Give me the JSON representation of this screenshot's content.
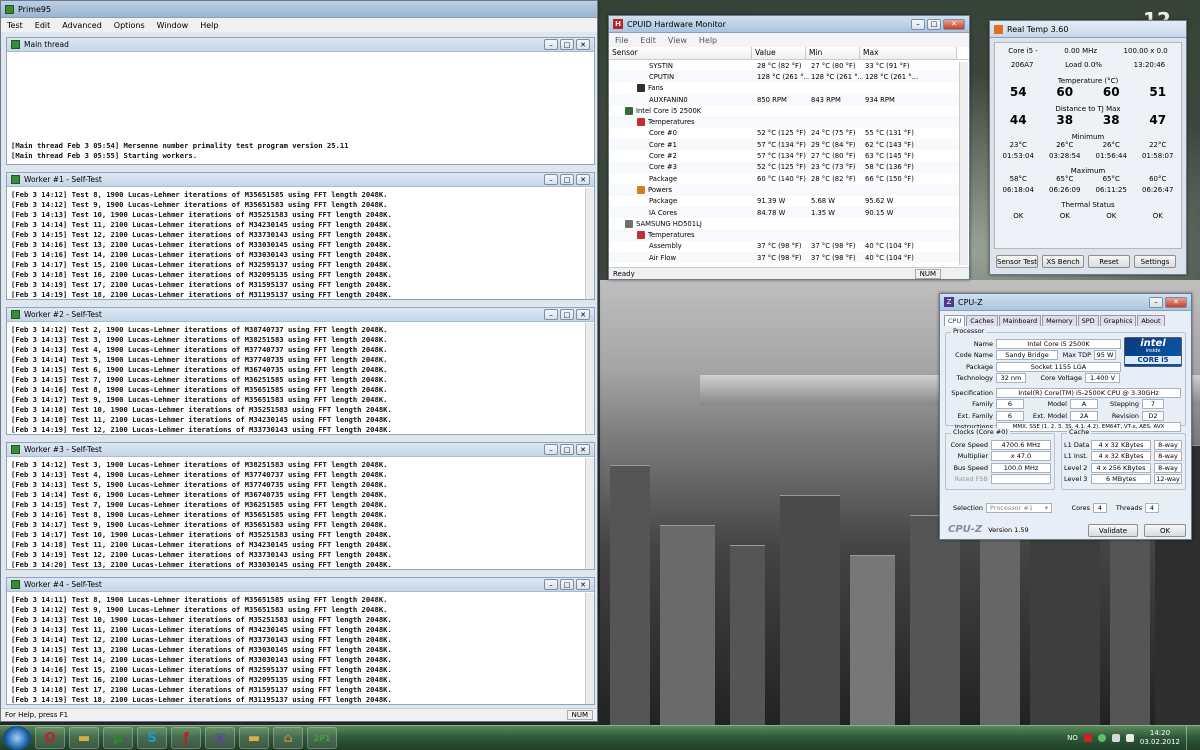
{
  "desktop": {
    "clock_big": "12"
  },
  "prime95": {
    "title": "Prime95",
    "menu": [
      "Test",
      "Edit",
      "Advanced",
      "Options",
      "Window",
      "Help"
    ],
    "main_thread": {
      "title": "Main thread",
      "lines": [
        "[Main thread Feb 3 05:54] Mersenne number primality test program version 25.11",
        "[Main thread Feb 3 05:55] Starting workers."
      ]
    },
    "workers": [
      {
        "title": "Worker #1 - Self-Test",
        "lines": [
          "[Feb 3 14:12] Test 8, 1900 Lucas-Lehmer iterations of M35651585 using FFT length 2048K.",
          "[Feb 3 14:12] Test 9, 1900 Lucas-Lehmer iterations of M35651583 using FFT length 2048K.",
          "[Feb 3 14:13] Test 10, 1900 Lucas-Lehmer iterations of M35251583 using FFT length 2048K.",
          "[Feb 3 14:14] Test 11, 2100 Lucas-Lehmer iterations of M34230145 using FFT length 2048K.",
          "[Feb 3 14:15] Test 12, 2100 Lucas-Lehmer iterations of M33730143 using FFT length 2048K.",
          "[Feb 3 14:16] Test 13, 2100 Lucas-Lehmer iterations of M33030145 using FFT length 2048K.",
          "[Feb 3 14:16] Test 14, 2100 Lucas-Lehmer iterations of M33030143 using FFT length 2048K.",
          "[Feb 3 14:17] Test 15, 2100 Lucas-Lehmer iterations of M32595137 using FFT length 2048K.",
          "[Feb 3 14:18] Test 16, 2100 Lucas-Lehmer iterations of M32095135 using FFT length 2048K.",
          "[Feb 3 14:19] Test 17, 2100 Lucas-Lehmer iterations of M31595137 using FFT length 2048K.",
          "[Feb 3 14:19] Test 18, 2100 Lucas-Lehmer iterations of M31195137 using FFT length 2048K."
        ]
      },
      {
        "title": "Worker #2 - Self-Test",
        "lines": [
          "[Feb 3 14:12] Test 2, 1900 Lucas-Lehmer iterations of M38740737 using FFT length 2048K.",
          "[Feb 3 14:13] Test 3, 1900 Lucas-Lehmer iterations of M38251583 using FFT length 2048K.",
          "[Feb 3 14:13] Test 4, 1900 Lucas-Lehmer iterations of M37740737 using FFT length 2048K.",
          "[Feb 3 14:14] Test 5, 1900 Lucas-Lehmer iterations of M37740735 using FFT length 2048K.",
          "[Feb 3 14:15] Test 6, 1900 Lucas-Lehmer iterations of M36740735 using FFT length 2048K.",
          "[Feb 3 14:15] Test 7, 1900 Lucas-Lehmer iterations of M36251585 using FFT length 2048K.",
          "[Feb 3 14:16] Test 8, 1900 Lucas-Lehmer iterations of M35651585 using FFT length 2048K.",
          "[Feb 3 14:17] Test 9, 1900 Lucas-Lehmer iterations of M35651583 using FFT length 2048K.",
          "[Feb 3 14:18] Test 10, 1900 Lucas-Lehmer iterations of M35251583 using FFT length 2048K.",
          "[Feb 3 14:18] Test 11, 2100 Lucas-Lehmer iterations of M34230145 using FFT length 2048K.",
          "[Feb 3 14:19] Test 12, 2100 Lucas-Lehmer iterations of M33730143 using FFT length 2048K."
        ]
      },
      {
        "title": "Worker #3 - Self-Test",
        "lines": [
          "[Feb 3 14:12] Test 3, 1900 Lucas-Lehmer iterations of M38251583 using FFT length 2048K.",
          "[Feb 3 14:13] Test 4, 1900 Lucas-Lehmer iterations of M37740737 using FFT length 2048K.",
          "[Feb 3 14:13] Test 5, 1900 Lucas-Lehmer iterations of M37740735 using FFT length 2048K.",
          "[Feb 3 14:14] Test 6, 1900 Lucas-Lehmer iterations of M36740735 using FFT length 2048K.",
          "[Feb 3 14:15] Test 7, 1900 Lucas-Lehmer iterations of M36251585 using FFT length 2048K.",
          "[Feb 3 14:16] Test 8, 1900 Lucas-Lehmer iterations of M35651585 using FFT length 2048K.",
          "[Feb 3 14:17] Test 9, 1900 Lucas-Lehmer iterations of M35651583 using FFT length 2048K.",
          "[Feb 3 14:17] Test 10, 1900 Lucas-Lehmer iterations of M35251583 using FFT length 2048K.",
          "[Feb 3 14:18] Test 11, 2100 Lucas-Lehmer iterations of M34230145 using FFT length 2048K.",
          "[Feb 3 14:19] Test 12, 2100 Lucas-Lehmer iterations of M33730143 using FFT length 2048K.",
          "[Feb 3 14:20] Test 13, 2100 Lucas-Lehmer iterations of M33030145 using FFT length 2048K."
        ]
      },
      {
        "title": "Worker #4 - Self-Test",
        "lines": [
          "[Feb 3 14:11] Test 8, 1900 Lucas-Lehmer iterations of M35651585 using FFT length 2048K.",
          "[Feb 3 14:12] Test 9, 1900 Lucas-Lehmer iterations of M35651583 using FFT length 2048K.",
          "[Feb 3 14:13] Test 10, 1900 Lucas-Lehmer iterations of M35251583 using FFT length 2048K.",
          "[Feb 3 14:13] Test 11, 2100 Lucas-Lehmer iterations of M34230145 using FFT length 2048K.",
          "[Feb 3 14:14] Test 12, 2100 Lucas-Lehmer iterations of M33730143 using FFT length 2048K.",
          "[Feb 3 14:15] Test 13, 2100 Lucas-Lehmer iterations of M33030145 using FFT length 2048K.",
          "[Feb 3 14:16] Test 14, 2100 Lucas-Lehmer iterations of M33030143 using FFT length 2048K.",
          "[Feb 3 14:16] Test 15, 2100 Lucas-Lehmer iterations of M32595137 using FFT length 2048K.",
          "[Feb 3 14:17] Test 16, 2100 Lucas-Lehmer iterations of M32095135 using FFT length 2048K.",
          "[Feb 3 14:18] Test 17, 2100 Lucas-Lehmer iterations of M31595137 using FFT length 2048K.",
          "[Feb 3 14:19] Test 18, 2100 Lucas-Lehmer iterations of M31195137 using FFT length 2048K."
        ]
      }
    ],
    "status_text": "For Help, press F1",
    "status_num": "NUM"
  },
  "hwmon": {
    "title": "CPUID Hardware Monitor",
    "menu": [
      "File",
      "Edit",
      "View",
      "Help"
    ],
    "columns": [
      "Sensor",
      "Value",
      "Min",
      "Max"
    ],
    "rows": [
      {
        "indent": 3,
        "name": "SYSTIN",
        "value": "28 °C (82 °F)",
        "min": "27 °C (80 °F)",
        "max": "33 °C (91 °F)"
      },
      {
        "indent": 3,
        "name": "CPUTIN",
        "value": "128 °C (261 °...",
        "min": "128 °C (261 °...",
        "max": "128 °C (261 °..."
      },
      {
        "indent": 2,
        "name": "Fans",
        "icon": "fan-icon",
        "value": "",
        "min": "",
        "max": ""
      },
      {
        "indent": 3,
        "name": "AUXFANIN0",
        "value": "850 RPM",
        "min": "843 RPM",
        "max": "934 RPM"
      },
      {
        "indent": 1,
        "name": "Intel Core i5 2500K",
        "icon": "cpu-icon",
        "value": "",
        "min": "",
        "max": ""
      },
      {
        "indent": 2,
        "name": "Temperatures",
        "icon": "thermometer-icon",
        "value": "",
        "min": "",
        "max": ""
      },
      {
        "indent": 3,
        "name": "Core #0",
        "value": "52 °C (125 °F)",
        "min": "24 °C (75 °F)",
        "max": "55 °C (131 °F)"
      },
      {
        "indent": 3,
        "name": "Core #1",
        "value": "57 °C (134 °F)",
        "min": "29 °C (84 °F)",
        "max": "62 °C (143 °F)"
      },
      {
        "indent": 3,
        "name": "Core #2",
        "value": "57 °C (134 °F)",
        "min": "27 °C (80 °F)",
        "max": "63 °C (145 °F)"
      },
      {
        "indent": 3,
        "name": "Core #3",
        "value": "52 °C (125 °F)",
        "min": "23 °C (73 °F)",
        "max": "58 °C (136 °F)"
      },
      {
        "indent": 3,
        "name": "Package",
        "value": "60 °C (140 °F)",
        "min": "28 °C (82 °F)",
        "max": "66 °C (150 °F)"
      },
      {
        "indent": 2,
        "name": "Powers",
        "icon": "power-icon",
        "value": "",
        "min": "",
        "max": ""
      },
      {
        "indent": 3,
        "name": "Package",
        "value": "91.39 W",
        "min": "5.68 W",
        "max": "95.62 W"
      },
      {
        "indent": 3,
        "name": "IA Cores",
        "value": "84.78 W",
        "min": "1.35 W",
        "max": "90.15 W"
      },
      {
        "indent": 1,
        "name": "SAMSUNG HD501LJ",
        "icon": "disk-icon",
        "value": "",
        "min": "",
        "max": ""
      },
      {
        "indent": 2,
        "name": "Temperatures",
        "icon": "thermometer-icon",
        "value": "",
        "min": "",
        "max": ""
      },
      {
        "indent": 3,
        "name": "Assembly",
        "value": "37 °C (98 °F)",
        "min": "37 °C (98 °F)",
        "max": "40 °C (104 °F)"
      },
      {
        "indent": 3,
        "name": "Air Flow",
        "value": "37 °C (98 °F)",
        "min": "37 °C (98 °F)",
        "max": "40 °C (104 °F)"
      }
    ],
    "status": "Ready",
    "num": "NUM"
  },
  "realtemp": {
    "title": "Real Temp 3.60",
    "cpu": "Core i5 -",
    "mhz": "0.00 MHz",
    "mult": "100.00 x 0.0",
    "id": "206A7",
    "load": "Load  0.0%",
    "time": "13:20:46",
    "temp_label": "Temperature (°C)",
    "temps": [
      "54",
      "60",
      "60",
      "51"
    ],
    "tj_label": "Distance to TJ Max",
    "tj": [
      "44",
      "38",
      "38",
      "47"
    ],
    "min_label": "Minimum",
    "mins": [
      "23°C",
      "26°C",
      "26°C",
      "22°C"
    ],
    "min_times": [
      "01:53:04",
      "03:28:54",
      "01:56:44",
      "01:58:07"
    ],
    "max_label": "Maximum",
    "maxs": [
      "58°C",
      "65°C",
      "65°C",
      "60°C"
    ],
    "max_times": [
      "06:18:04",
      "06:26:09",
      "06:11:25",
      "06:26:47"
    ],
    "thermal_label": "Thermal Status",
    "thermal": [
      "OK",
      "OK",
      "OK",
      "OK"
    ],
    "buttons": [
      "Sensor Test",
      "XS Bench",
      "Reset",
      "Settings"
    ]
  },
  "cpuz": {
    "title": "CPU-Z",
    "tabs": [
      "CPU",
      "Caches",
      "Mainboard",
      "Memory",
      "SPD",
      "Graphics",
      "About"
    ],
    "processor_label": "Processor",
    "name_label": "Name",
    "name": "Intel Core i5 2500K",
    "codename_label": "Code Name",
    "codename": "Sandy Bridge",
    "tdp_label": "Max TDP",
    "tdp": "95 W",
    "package_label": "Package",
    "package": "Socket 1155 LGA",
    "tech_label": "Technology",
    "tech": "32 nm",
    "voltage_label": "Core Voltage",
    "voltage": "1.400 V",
    "spec_label": "Specification",
    "spec": "Intel(R) Core(TM) i5-2500K CPU @ 3.30GHz",
    "family_label": "Family",
    "family": "6",
    "model_label": "Model",
    "model": "A",
    "stepping_label": "Stepping",
    "stepping": "7",
    "extfamily_label": "Ext. Family",
    "extfamily": "6",
    "extmodel_label": "Ext. Model",
    "extmodel": "2A",
    "revision_label": "Revision",
    "revision": "D2",
    "instr_label": "Instructions",
    "instr": "MMX, SSE (1, 2, 3, 3S, 4.1, 4.2), EM64T, VT-x, AES, AVX",
    "clocks_label": "Clocks (Core #0)",
    "corespeed_label": "Core Speed",
    "corespeed": "4700.6 MHz",
    "mult_label": "Multiplier",
    "mult": "x 47.0",
    "bus_label": "Bus Speed",
    "bus": "100.0 MHz",
    "fsb_label": "Rated FSB",
    "fsb": "",
    "cache_label": "Cache",
    "l1d_label": "L1 Data",
    "l1d": "4 x 32 KBytes",
    "l1d_way": "8-way",
    "l1i_label": "L1 Inst.",
    "l1i": "4 x 32 KBytes",
    "l1i_way": "8-way",
    "l2_label": "Level 2",
    "l2": "4 x 256 KBytes",
    "l2_way": "8-way",
    "l3_label": "Level 3",
    "l3": "6 MBytes",
    "l3_way": "12-way",
    "selection_label": "Selection",
    "selection": "Processor #1",
    "cores_label": "Cores",
    "cores": "4",
    "threads_label": "Threads",
    "threads": "4",
    "logo": "CPU-Z",
    "version": "Version 1.59",
    "validate": "Validate",
    "ok": "OK",
    "badge_top": "intel",
    "badge_inside": "inside",
    "badge_bottom": "CORE i5"
  },
  "taskbar": {
    "apps": [
      {
        "name": "opera-icon",
        "glyph": "O",
        "color": "#c0202a"
      },
      {
        "name": "folder-icon",
        "glyph": "▬",
        "color": "#d8b040"
      },
      {
        "name": "utorrent-icon",
        "glyph": "µ",
        "color": "#2a8a2a"
      },
      {
        "name": "skype-icon",
        "glyph": "S",
        "color": "#1a9ad8"
      },
      {
        "name": "flash-icon",
        "glyph": "ƒ",
        "color": "#c02020"
      },
      {
        "name": "cpuz-icon",
        "glyph": "▣",
        "color": "#5a4a8a"
      },
      {
        "name": "explorer-folder-icon",
        "glyph": "▬",
        "color": "#d8b040"
      },
      {
        "name": "realtemp-icon",
        "glyph": "⌂",
        "color": "#b08a40"
      },
      {
        "name": "prime95-icon",
        "glyph": "2P1",
        "color": "#40a040"
      }
    ],
    "lang": "NO",
    "time": "14:20",
    "date": "03.02.2012"
  }
}
